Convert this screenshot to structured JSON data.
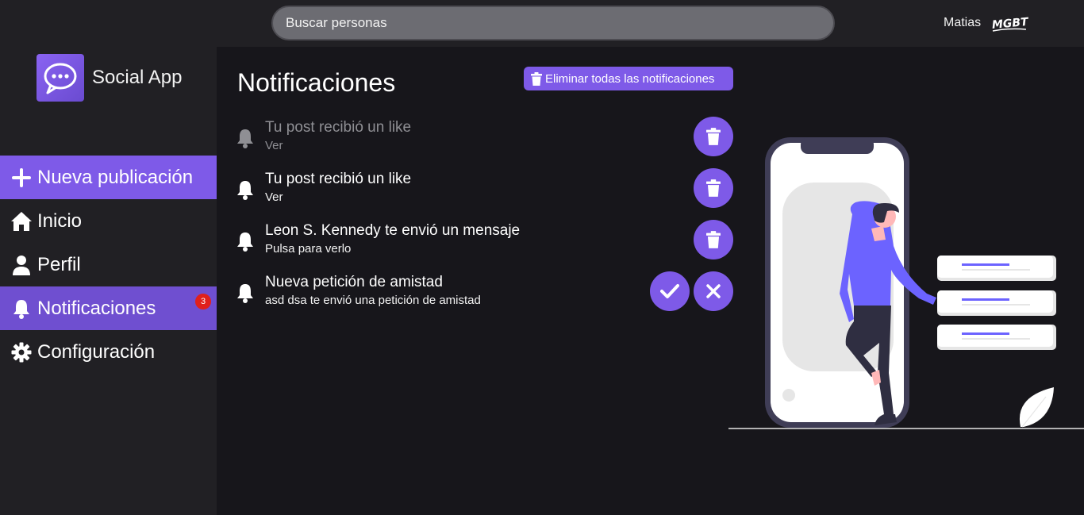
{
  "header": {
    "search_placeholder": "Buscar personas",
    "username": "Matias",
    "user_logo_text": "MGBT"
  },
  "sidebar": {
    "brand": "Social App",
    "items": [
      {
        "label": "Nueva publicación",
        "icon": "plus-icon"
      },
      {
        "label": "Inicio",
        "icon": "home-icon"
      },
      {
        "label": "Perfil",
        "icon": "user-icon"
      },
      {
        "label": "Notificaciones",
        "icon": "bell-icon",
        "badge": "3"
      },
      {
        "label": "Configuración",
        "icon": "gear-icon"
      }
    ]
  },
  "main": {
    "title": "Notificaciones",
    "clear_all_label": "Eliminar todas las notificaciones",
    "notifications": [
      {
        "title": "Tu post recibió un like",
        "subtitle": "Ver",
        "read": true,
        "actions": [
          "delete"
        ]
      },
      {
        "title": "Tu post recibió un like",
        "subtitle": "Ver",
        "read": false,
        "actions": [
          "delete"
        ]
      },
      {
        "title": "Leon S. Kennedy te envió un mensaje",
        "subtitle": "Pulsa para verlo",
        "read": false,
        "actions": [
          "delete"
        ]
      },
      {
        "title": "Nueva petición de amistad",
        "subtitle": "asd dsa te envió una petición de amistad",
        "read": false,
        "actions": [
          "accept",
          "reject"
        ]
      }
    ]
  },
  "colors": {
    "accent": "#7e5ae8",
    "background": "#17161b",
    "panel": "#212024",
    "badge": "#e0201c"
  }
}
